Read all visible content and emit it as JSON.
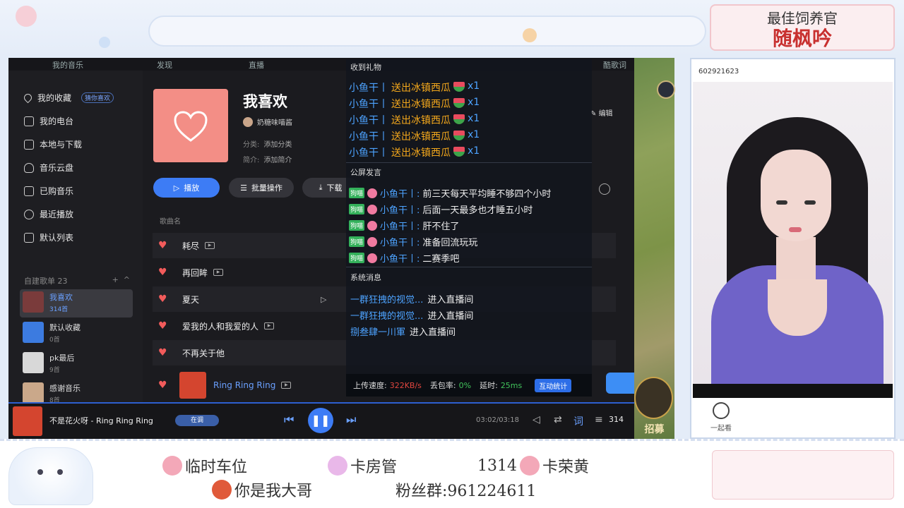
{
  "frame": {
    "title_top": "最佳饲养官",
    "title_bottom": "随枫吟",
    "bottom": {
      "item1": "临时车位",
      "item2": "卡房管",
      "item3_num": "1314",
      "item3_label": "卡荣黄",
      "item4": "你是我大哥",
      "fans_group": "粉丝群:961224611"
    }
  },
  "app": {
    "topbar": {
      "music": "我的音乐",
      "discover": "发现",
      "live": "直播",
      "lyrics": "酷歌词"
    },
    "sidebar": {
      "items": [
        {
          "label": "我的收藏",
          "badge": "猜你喜欢"
        },
        {
          "label": "我的电台"
        },
        {
          "label": "本地与下载"
        },
        {
          "label": "音乐云盘"
        },
        {
          "label": "已购音乐"
        },
        {
          "label": "最近播放"
        },
        {
          "label": "默认列表"
        }
      ],
      "section_label": "自建歌单",
      "section_count": "23",
      "add": "+",
      "collapse": "^",
      "playlists": [
        {
          "name": "我喜欢",
          "count": "314首"
        },
        {
          "name": "默认收藏",
          "count": "0首"
        },
        {
          "name": "pk最后",
          "count": "9首"
        },
        {
          "name": "感谢音乐",
          "count": "8首"
        }
      ]
    },
    "playlist": {
      "title": "我喜欢",
      "owner": "奶糖味喵酱",
      "category_label": "分类:",
      "category_value": "添加分类",
      "intro_label": "简介:",
      "intro_value": "添加简介",
      "play": "播放",
      "batch": "批量操作",
      "download": "下载",
      "edit": "编辑",
      "column_song": "歌曲名"
    },
    "songs": [
      {
        "name": "耗尽"
      },
      {
        "name": "再回眸"
      },
      {
        "name": "夏天"
      },
      {
        "name": "爱我的人和我爱的人"
      },
      {
        "name": "不再关于他"
      },
      {
        "name": "Ring Ring Ring"
      }
    ],
    "player": {
      "now_playing": "不是花火呀 - Ring Ring Ring",
      "listening": "在调",
      "time": "03:02/03:18",
      "lyric_btn": "词",
      "count": "314",
      "progress": 0.95
    }
  },
  "overlay": {
    "gifts_title": "收到礼物",
    "gifts": [
      {
        "user": "小鱼干丨",
        "text": "送出冰镇西瓜",
        "qty": "x1"
      },
      {
        "user": "小鱼干丨",
        "text": "送出冰镇西瓜",
        "qty": "x1"
      },
      {
        "user": "小鱼干丨",
        "text": "送出冰镇西瓜",
        "qty": "x1"
      },
      {
        "user": "小鱼干丨",
        "text": "送出冰镇西瓜",
        "qty": "x1"
      },
      {
        "user": "小鱼干丨",
        "text": "送出冰镇西瓜",
        "qty": "x1"
      }
    ],
    "chat_title": "公屏发言",
    "chats": [
      {
        "badge": "狗喵",
        "user": "小鱼干丨:",
        "text": "前三天每天平均睡不够四个小时"
      },
      {
        "badge": "狗喵",
        "user": "小鱼干丨:",
        "text": "后面一天最多也才睡五小时"
      },
      {
        "badge": "狗喵",
        "user": "小鱼干丨:",
        "text": "肝不住了"
      },
      {
        "badge": "狗喵",
        "user": "小鱼干丨:",
        "text": "准备回流玩玩"
      },
      {
        "badge": "狗喵",
        "user": "小鱼干丨:",
        "text": "二赛季吧"
      }
    ],
    "system_title": "系统消息",
    "system": [
      {
        "user": "一群狂拽的视觉...",
        "text": "进入直播间"
      },
      {
        "user": "一群狂拽的视觉...",
        "text": "进入直播间"
      },
      {
        "user": "捌叁肆一川軍",
        "text": "进入直播间"
      }
    ],
    "stats": {
      "upload_label": "上传速度:",
      "upload_value": "322KB/s",
      "loss_label": "丢包率:",
      "loss_value": "0%",
      "delay_label": "延时:",
      "delay_value": "25ms",
      "interact_btn": "互动统计"
    }
  },
  "game": {
    "recruit": "招募"
  },
  "camera": {
    "room_id": "602921623",
    "together": "一起看"
  }
}
